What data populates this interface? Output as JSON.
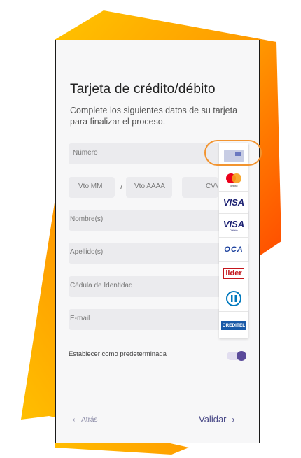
{
  "form": {
    "title": "Tarjeta de crédito/débito",
    "subtitle": "Complete los siguientes datos de su tarjeta para finalizar el proceso.",
    "numero_placeholder": "Número",
    "vto_mm_placeholder": "Vto MM",
    "date_separator": "/",
    "vto_aaaa_placeholder": "Vto AAAA",
    "cvv_placeholder": "CVV",
    "nombre_placeholder": "Nombre(s)",
    "apellido_placeholder": "Apellido(s)",
    "cedula_placeholder": "Cédula de Identidad",
    "email_placeholder": "E-mail",
    "default_label": "Establecer como predeterminada",
    "default_toggle_on": true
  },
  "footer": {
    "back_label": "Atrás",
    "back_icon": "chevron-left-icon",
    "validate_label": "Validar",
    "validate_icon": "chevron-right-icon"
  },
  "brands": {
    "items": [
      {
        "name": "generic-card",
        "label": ""
      },
      {
        "name": "mastercard-debit",
        "label": "debito"
      },
      {
        "name": "visa",
        "label": "VISA"
      },
      {
        "name": "visa-debito",
        "label": "VISA",
        "sub": "Débito"
      },
      {
        "name": "oca",
        "label": "OCA"
      },
      {
        "name": "lider",
        "label": "lider"
      },
      {
        "name": "diners",
        "label": ""
      },
      {
        "name": "creditel",
        "label": "CREDITEL"
      }
    ]
  },
  "colors": {
    "accent_orange": "#f29430",
    "shape_yellow": "#ffb000",
    "shape_orange": "#ff5a00",
    "toggle_knob": "#5a4a9a",
    "validate_text": "#4b4b88"
  }
}
